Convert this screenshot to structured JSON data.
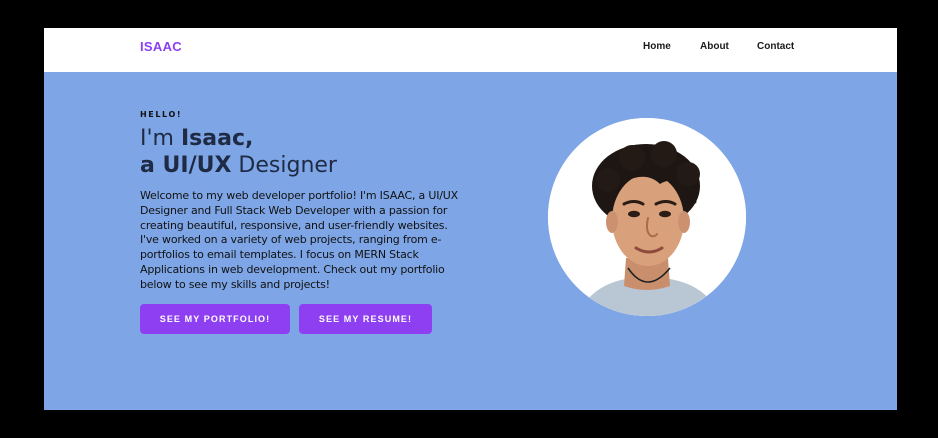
{
  "nav": {
    "logo": "ISAAC",
    "links": [
      "Home",
      "About",
      "Contact"
    ]
  },
  "hero": {
    "greeting": "HELLO!",
    "line1_prefix": "I'm ",
    "line1_name": "Isaac,",
    "line2_prefix": "a ",
    "line2_role": "UI/UX",
    "line2_suffix": " Designer",
    "intro": "Welcome to my web developer portfolio! I'm ISAAC, a UI/UX Designer and Full Stack Web Developer with a passion for creating beautiful, responsive, and user-friendly websites. I've worked on a variety of web projects, ranging from e-portfolios to email templates. I focus on MERN Stack Applications in web development. Check out my portfolio below to see my skills and projects!",
    "buttons": {
      "portfolio": "SEE MY PORTFOLIO!",
      "resume": "SEE MY RESUME!"
    },
    "avatar_icon": "profile-photo"
  },
  "colors": {
    "accent": "#8f3ff2",
    "hero_background": "#7ea6e6",
    "navbar_background": "#ffffff",
    "heading_text": "#1f2a44"
  }
}
